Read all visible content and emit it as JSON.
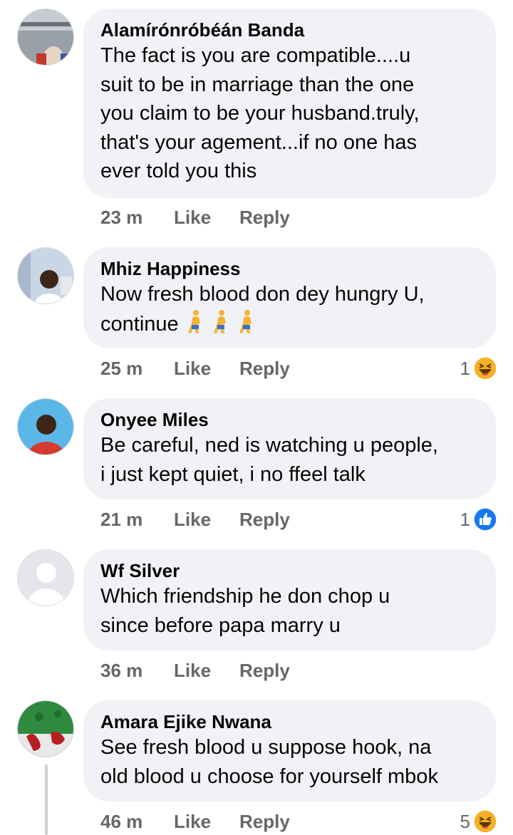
{
  "comments": [
    {
      "author": "Alamírónróbéán Banda",
      "lines": [
        "The fact is you are compatible....u",
        "suit to be in marriage than the one",
        "you claim to be your husband.truly,",
        "that's your agement...if no one has",
        "ever told you this"
      ],
      "time": "23 m",
      "like": "Like",
      "reply": "Reply",
      "avatar_icon": "person-photo-avatar",
      "avatar_colors": [
        "#8a8f9a",
        "#e0d3c6",
        "#3a5a9c"
      ]
    },
    {
      "author": "Mhiz Happiness",
      "lines": [
        "Now fresh blood don dey hungry U,",
        "continue"
      ],
      "emoji_icon": "person-walking-emoji",
      "time": "25 m",
      "like": "Like",
      "reply": "Reply",
      "reaction_count": "1",
      "reaction_icon": "haha-reaction-icon",
      "avatar_colors": [
        "#c9d6e6",
        "#3b2618",
        "#ffffff"
      ]
    },
    {
      "author": "Onyee Miles",
      "lines": [
        "Be careful, ned is watching u people,",
        "i just kept quiet, i no ffeel talk"
      ],
      "time": "21 m",
      "like": "Like",
      "reply": "Reply",
      "reaction_count": "1",
      "reaction_icon": "like-reaction-icon",
      "avatar_colors": [
        "#5bb7e8",
        "#3b2618",
        "#d63b2f"
      ]
    },
    {
      "author": "Wf Silver",
      "lines": [
        "Which friendship he don chop u",
        "since before papa marry u"
      ],
      "time": "36 m",
      "like": "Like",
      "reply": "Reply",
      "avatar_icon": "default-silhouette-avatar",
      "avatar_colors": [
        "#e4e6eb",
        "#ffffff"
      ]
    },
    {
      "author": "Amara Ejike Nwana",
      "lines": [
        "See fresh blood u suppose hook, na",
        "old blood u choose for yourself mbok"
      ],
      "time": "46 m",
      "like": "Like",
      "reply": "Reply",
      "reaction_count": "5",
      "reaction_icon": "haha-reaction-icon",
      "avatar_colors": [
        "#2d8a3e",
        "#b51f24",
        "#e8e8e8"
      ]
    }
  ],
  "colors": {
    "bubble": "#f0f2f5",
    "meta_text": "#65676b",
    "like_blue": "#1877f2",
    "haha_yellow": "#f7b125"
  }
}
